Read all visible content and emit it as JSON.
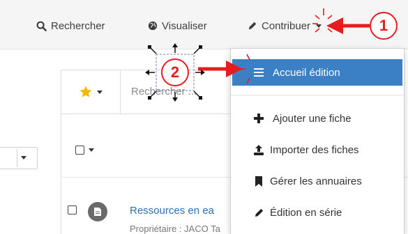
{
  "header": {
    "nav": [
      {
        "label": "Rechercher",
        "icon": "search-icon"
      },
      {
        "label": "Visualiser",
        "icon": "globe-icon"
      },
      {
        "label": "Contribuer",
        "icon": "pencil-icon"
      }
    ]
  },
  "toolbar": {
    "search_placeholder": "Rechercher ..."
  },
  "dropdown": {
    "items": [
      {
        "label": "Accueil édition",
        "icon": "menu-lines-icon",
        "active": true
      },
      {
        "label": "Ajouter une fiche",
        "icon": "plus-icon"
      },
      {
        "label": "Importer des fiches",
        "icon": "upload-icon"
      },
      {
        "label": "Gérer les annuaires",
        "icon": "bookmark-icon"
      },
      {
        "label": "Édition en série",
        "icon": "pencil-icon"
      }
    ]
  },
  "list": {
    "row": {
      "title": "Ressources en ea",
      "owner": "Propriétaire : JACO Ta"
    }
  },
  "annotations": {
    "badge1": "1",
    "badge2": "2"
  },
  "colors": {
    "accent_blue": "#3b7fc4",
    "annotation_red": "#e81c1c",
    "star_gold": "#f5b800"
  }
}
